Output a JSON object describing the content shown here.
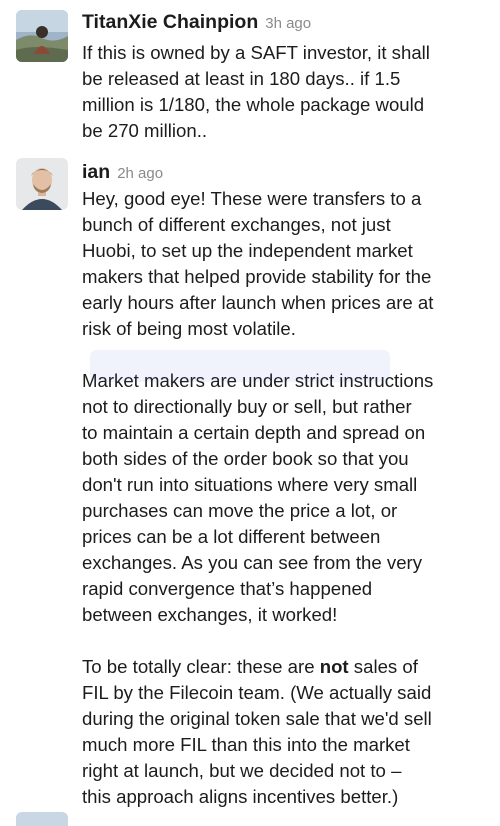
{
  "messages": [
    {
      "author": "TitanXie Chainpion",
      "time": "3h ago",
      "paragraphs": [
        [
          "If this is owned by a SAFT investor, it shall",
          "be released at least in 180 days.. if 1.5",
          "million is 1/180, the whole package would",
          "be 270 million.."
        ]
      ]
    },
    {
      "author": "ian",
      "time": "2h ago",
      "paragraphs": [
        [
          "Hey, good eye! These were transfers to a",
          "bunch of different exchanges, not just",
          "Huobi, to set up the independent market",
          "makers that helped provide stability for the",
          "early hours after launch when prices are at",
          "risk of being most volatile."
        ],
        [
          "Market makers are under strict instructions",
          "not to directionally buy or sell, but rather",
          "to maintain a certain depth and spread on",
          "both sides of the order book so that you",
          "don't run into situations where very small",
          "purchases can move the price a lot, or",
          "prices can be a lot different between",
          "exchanges. As you can see from the very",
          "rapid convergence that’s happened",
          "between exchanges, it worked!"
        ],
        [
          "To be totally clear: these are not sales of",
          "FIL by the Filecoin team. (We actually said",
          "during the original token sale that we'd sell",
          "much more FIL than this into the market",
          "right at launch, but we decided not to –",
          " this approach aligns incentives better.)"
        ]
      ]
    }
  ]
}
